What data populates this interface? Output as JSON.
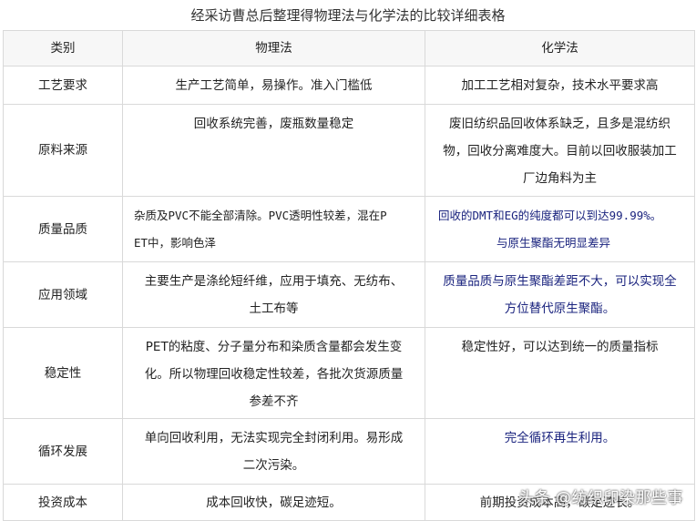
{
  "title": "经采访曹总后整理得物理法与化学法的比较详细表格",
  "headers": [
    "类别",
    "物理法",
    "化学法"
  ],
  "rows": [
    {
      "label": "工艺要求",
      "physical": [
        "生产工艺简单，易操作。准入门槛低"
      ],
      "chemical": [
        "加工工艺相对复杂，技术水平要求高"
      ]
    },
    {
      "label": "原料来源",
      "physical": [
        "回收系统完善，废瓶数量稳定"
      ],
      "chemical": [
        "废旧纺织品回收体系缺乏，且多是混纺织",
        "物，回收分离难度大。目前以回收服装加工",
        "厂边角料为主"
      ]
    },
    {
      "label": "质量品质",
      "physical": [
        "杂质及PVC不能全部清除。PVC透明性较差，混在P",
        "ET中，影响色泽"
      ],
      "chemical": [
        "回收的DMT和EG的纯度都可以到达99.99%。",
        "与原生聚酯无明显差异"
      ]
    },
    {
      "label": "应用领域",
      "physical": [
        "主要生产是涤纶短纤维，应用于填充、无纺布、",
        "土工布等"
      ],
      "chemical": [
        "质量品质与原生聚酯差距不大，可以实现全",
        "方位替代原生聚酯。"
      ]
    },
    {
      "label": "稳定性",
      "physical": [
        "PET的粘度、分子量分布和染质含量都会发生变",
        "化。所以物理回收稳定性较差，各批次货源质量",
        "参差不齐"
      ],
      "chemical": [
        "稳定性好，可以达到统一的质量指标"
      ]
    },
    {
      "label": "循环发展",
      "physical": [
        "单向回收利用，无法实现完全封闭利用。易形成",
        "二次污染。"
      ],
      "chemical": [
        "完全循环再生利用。"
      ]
    },
    {
      "label": "投资成本",
      "physical": [
        "成本回收快，碳足迹短。"
      ],
      "chemical": [
        "前期投资成本高，碳足迹长。"
      ]
    }
  ],
  "watermark": "头条 @纺织印染那些事",
  "colors": {
    "border": "#d9d9d9",
    "header_bg": "#f7f7f7",
    "blue_text": "#1a237e"
  }
}
